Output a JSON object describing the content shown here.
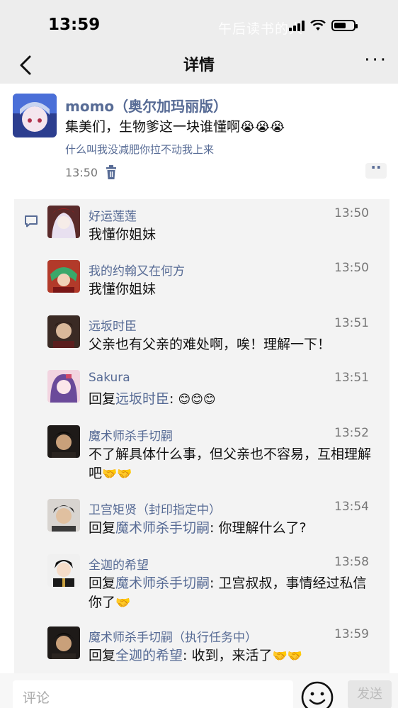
{
  "status_bar": {
    "time": "13:59",
    "watermark": "午后读书的人"
  },
  "navbar": {
    "back_icon": "chevron-left-icon",
    "title": "详情",
    "more_icon": "more-dots-icon"
  },
  "post": {
    "author": "momo（奥尔加玛丽版）",
    "text": "集美们，生物爹这一块谁懂啊",
    "text_emoji": "😭😭😭",
    "link": "什么叫我没减肥你拉不动我上来",
    "time": "13:50"
  },
  "comments": [
    {
      "name": "好运莲莲",
      "time": "13:50",
      "prefix": "",
      "ref": "",
      "sep": "",
      "text": "我懂你姐妹",
      "emoji": "",
      "avatar_colors": [
        "#5a2a2a",
        "#e8e0f0"
      ]
    },
    {
      "name": "我的约翰又在何方",
      "time": "13:50",
      "prefix": "",
      "ref": "",
      "sep": "",
      "text": "我懂你姐妹",
      "emoji": "",
      "avatar_colors": [
        "#b23a2a",
        "#3aa86a"
      ]
    },
    {
      "name": "远坂时臣",
      "time": "13:51",
      "prefix": "",
      "ref": "",
      "sep": "",
      "text": "父亲也有父亲的难处啊，唉！理解一下！",
      "emoji": "",
      "avatar_colors": [
        "#3a2a24",
        "#d9b89a"
      ]
    },
    {
      "name": "Sakura",
      "time": "13:51",
      "prefix": "回复",
      "ref": "远坂时臣",
      "sep": ": ",
      "text": "",
      "emoji": "😊😊😊",
      "avatar_colors": [
        "#6b4a9a",
        "#f2d4e0"
      ]
    },
    {
      "name": "魔术师杀手切嗣",
      "time": "13:52",
      "prefix": "",
      "ref": "",
      "sep": "",
      "text": "不了解具体什么事，但父亲也不容易，互相理解吧",
      "emoji": "🤝🤝",
      "avatar_colors": [
        "#1e1a18",
        "#c9a07a"
      ]
    },
    {
      "name": "卫宫矩贤（封印指定中）",
      "time": "13:54",
      "prefix": "回复",
      "ref": "魔术师杀手切嗣",
      "sep": ": ",
      "text": "你理解什么了?",
      "emoji": "",
      "avatar_colors": [
        "#2a2a2a",
        "#e0c0a0"
      ]
    },
    {
      "name": "全迦的希望",
      "time": "13:58",
      "prefix": "回复",
      "ref": "魔术师杀手切嗣",
      "sep": ": ",
      "text": "卫宫叔叔，事情经过私信你了",
      "emoji": "🤝",
      "avatar_colors": [
        "#111111",
        "#f0f0f0"
      ]
    },
    {
      "name": "魔术师杀手切嗣（执行任务中）",
      "time": "13:59",
      "prefix": "回复",
      "ref": "全迦的希望",
      "sep": ": ",
      "text": "收到，来活了",
      "emoji": "🤝🤝",
      "avatar_colors": [
        "#1e1a18",
        "#c9a07a"
      ]
    }
  ],
  "input_bar": {
    "placeholder": "评论",
    "send_label": "发送"
  },
  "colors": {
    "link": "#576b95",
    "background": "#ededed"
  }
}
